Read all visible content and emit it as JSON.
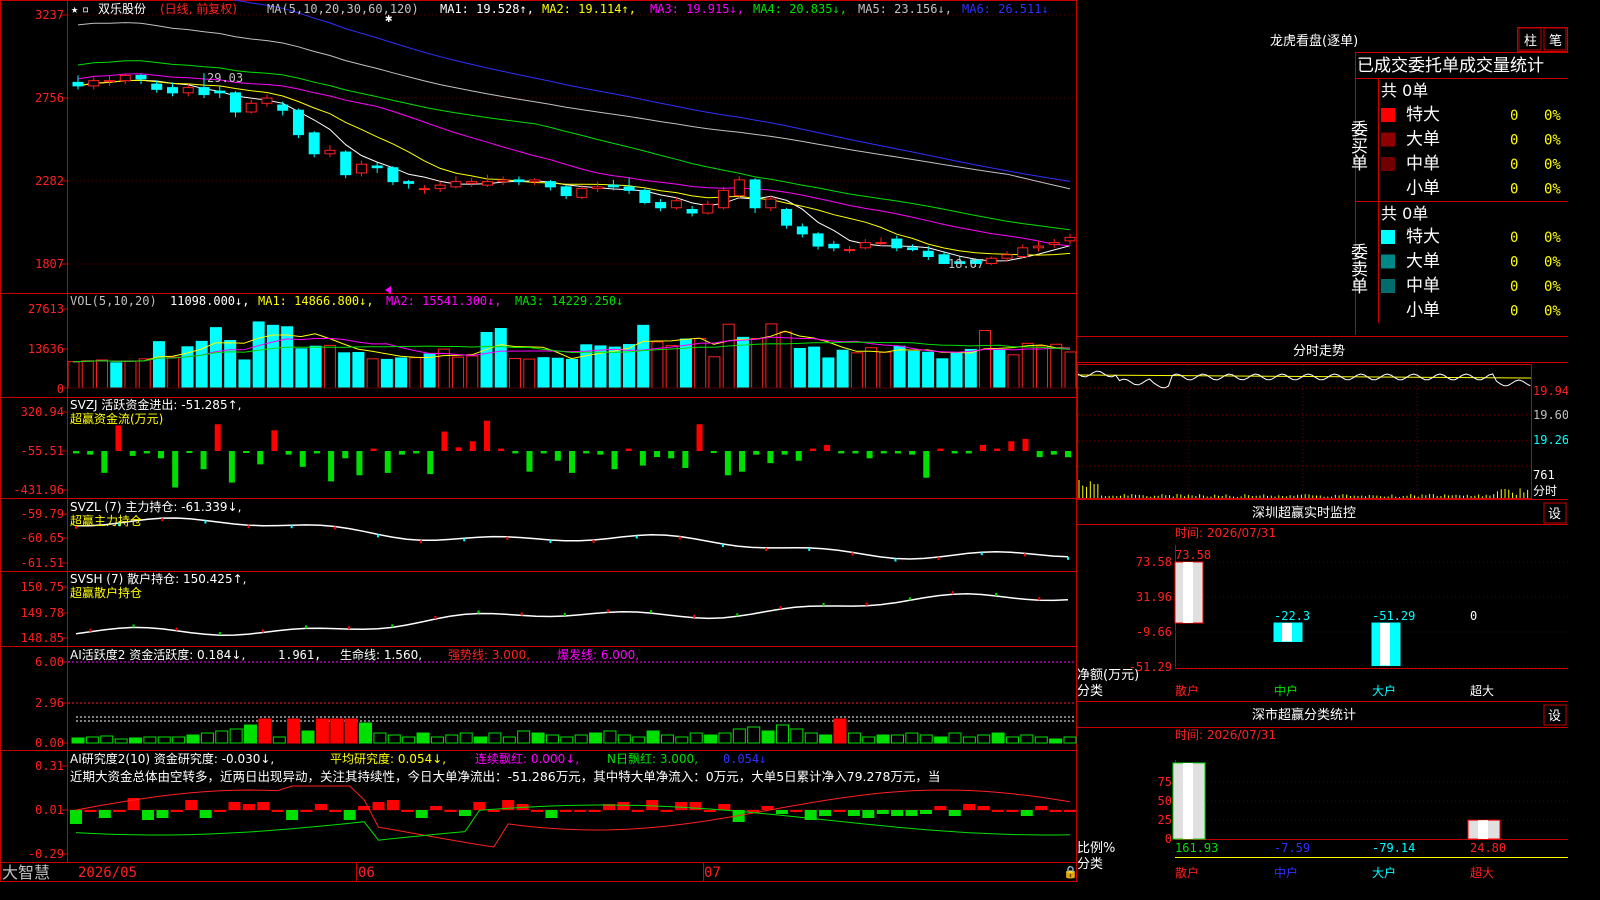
{
  "colors": {
    "up": "#ff2020",
    "down": "#00ffff",
    "green": "#00e000",
    "grid": "#c80000",
    "yellow": "#ffff00",
    "magenta": "#ff00ff",
    "blue": "#3030ff",
    "white": "#ffffff"
  },
  "main": {
    "stock": "双乐股份",
    "period": "(日线, 前复权)",
    "ma_params": "MA(5,10,20,30,60,120)",
    "ma_labels": [
      {
        "text": "MA1: 19.528↑,",
        "color": "#ffffff"
      },
      {
        "text": "MA2: 19.114↑,",
        "color": "#ffff00"
      },
      {
        "text": "MA3: 19.915↓,",
        "color": "#ff00ff"
      },
      {
        "text": "MA4: 20.835↓,",
        "color": "#00e000"
      },
      {
        "text": "MA5: 23.156↓,",
        "color": "#c0c0c0"
      },
      {
        "text": "MA6: 26.511↓",
        "color": "#3030ff"
      }
    ],
    "yticks": [
      "3237",
      "2756",
      "2282",
      "1807"
    ],
    "high_label": "29.03",
    "low_label": "18.07"
  },
  "vol": {
    "title": "VOL(5,10,20)",
    "v": "11098.000↓,",
    "ma1": "MA1: 14866.800↓,",
    "ma2": "MA2: 15541.300↓,",
    "ma3": "MA3: 14229.250↓",
    "yticks": [
      "27613",
      "13636",
      "0"
    ]
  },
  "svzj": {
    "title": "SVZJ  活跃资金进出: -51.285↑,",
    "sub": "超赢资金流(万元)",
    "yticks": [
      "320.94",
      "-55.51",
      "-431.96"
    ]
  },
  "svzl": {
    "title": "SVZL (7) 主力持仓: -61.339↓,",
    "sub": "超赢主力持仓",
    "yticks": [
      "-59.79",
      "-60.65",
      "-61.51"
    ]
  },
  "svsh": {
    "title": "SVSH (7) 散户持仓: 150.425↑,",
    "sub": "超赢散户持仓",
    "yticks": [
      "150.75",
      "149.78",
      "148.85"
    ]
  },
  "ai1": {
    "title": "AI活跃度2 资金活跃度: 0.184↓,",
    "v2": "1.961,",
    "v3": "生命线: 1.560,",
    "v4": "强势线: 3.000,",
    "v5": "爆发线: 6.000,",
    "yticks": [
      "6.00",
      "2.96",
      "0.00"
    ]
  },
  "ai2": {
    "title": "AI研究度2(10) 资金研究度: -0.030↓,",
    "v2": "平均研究度: 0.054↓,",
    "v3": "连续飘红: 0.000↓,",
    "v4": "N日飘红: 3.000,",
    "v5": "0.054↓",
    "desc": "近期大资金总体由空转多，近两日出现异动，关注其持续性，今日大单净流出：-51.286万元，其中特大单净流入：0万元，大单5日累计净入79.278万元，当",
    "yticks": [
      "0.31",
      "0.01",
      "-0.29"
    ]
  },
  "xaxis": {
    "brand": "大智慧",
    "labels": [
      "2026/05",
      "06",
      "07"
    ]
  },
  "dragon": {
    "title": "龙虎看盘(逐单)",
    "btn1": "柱",
    "btn2": "笔",
    "subtitle": "已成交委托单成交量统计",
    "buy_side": "委买单",
    "sell_side": "委卖单",
    "buy_total": "共 0单",
    "sell_total": "共 0单",
    "buy_rows": [
      {
        "name": "特大",
        "v": "0",
        "p": "0%",
        "c": "#ff0000"
      },
      {
        "name": "大单",
        "v": "0",
        "p": "0%",
        "c": "#900000"
      },
      {
        "name": "中单",
        "v": "0",
        "p": "0%",
        "c": "#700000"
      },
      {
        "name": "小单",
        "v": "0",
        "p": "0%",
        "c": ""
      }
    ],
    "sell_rows": [
      {
        "name": "特大",
        "v": "0",
        "p": "0%",
        "c": "#00ffff"
      },
      {
        "name": "大单",
        "v": "0",
        "p": "0%",
        "c": "#008888"
      },
      {
        "name": "中单",
        "v": "0",
        "p": "0%",
        "c": "#006c6c"
      },
      {
        "name": "小单",
        "v": "0",
        "p": "0%",
        "c": ""
      }
    ]
  },
  "intraday": {
    "title": "分时走势",
    "prices": [
      "19.94",
      "19.60",
      "19.26"
    ],
    "vol": "761",
    "unit": "分时"
  },
  "monitor": {
    "title": "深圳超赢实时监控",
    "btn": "设",
    "time": "时间: 2026/07/31",
    "yticks": [
      "73.58",
      "31.96",
      "-9.66",
      "-51.29"
    ],
    "ylabel": "净额(万元)",
    "xlabel": "分类",
    "categories": [
      "散户",
      "中户",
      "大户",
      "超大"
    ],
    "values": [
      73.58,
      -22.3,
      -51.29,
      0
    ],
    "value_labels": [
      "73.58",
      "-22.3",
      "-51.29",
      "0"
    ]
  },
  "classify": {
    "title": "深市超赢分类统计",
    "btn": "设",
    "time": "时间: 2026/07/31",
    "yticks": [
      "75",
      "50",
      "25",
      "0"
    ],
    "ylabel": "比例%",
    "xlabel": "分类",
    "categories": [
      "散户",
      "中户",
      "大户",
      "超大"
    ],
    "values": [
      161.93,
      -7.59,
      -79.14,
      24.8
    ],
    "value_labels": [
      "161.93",
      "-7.59",
      "-79.14",
      "24.80"
    ]
  },
  "chart_data": [
    {
      "type": "candlestick",
      "title": "双乐股份",
      "ylim": [
        17.5,
        32.8
      ],
      "ohlc": [
        [
          28.5,
          28.3,
          28.9,
          28.1
        ],
        [
          28.3,
          28.6,
          28.8,
          28.1
        ],
        [
          28.6,
          28.6,
          28.9,
          28.3
        ],
        [
          28.6,
          28.9,
          29.0,
          28.4
        ],
        [
          28.9,
          28.7,
          29.0,
          28.4
        ],
        [
          28.4,
          28.1,
          28.6,
          27.9
        ],
        [
          28.2,
          27.9,
          28.5,
          27.7
        ],
        [
          27.9,
          28.2,
          28.4,
          27.7
        ],
        [
          28.2,
          27.8,
          29.03,
          27.6
        ],
        [
          28.0,
          27.9,
          28.3,
          27.6
        ],
        [
          27.9,
          26.8,
          28.0,
          26.5
        ],
        [
          26.8,
          27.3,
          27.5,
          26.7
        ],
        [
          27.3,
          27.6,
          27.8,
          27.1
        ],
        [
          27.2,
          26.9,
          27.4,
          26.6
        ],
        [
          26.9,
          25.5,
          27.0,
          25.3
        ],
        [
          25.6,
          24.4,
          25.7,
          24.2
        ],
        [
          24.4,
          24.6,
          24.9,
          24.2
        ],
        [
          24.5,
          23.2,
          24.6,
          23.0
        ],
        [
          23.3,
          23.8,
          24.0,
          23.1
        ],
        [
          23.7,
          23.6,
          23.9,
          23.3
        ],
        [
          23.6,
          22.8,
          23.7,
          22.6
        ],
        [
          22.8,
          22.7,
          22.9,
          22.4
        ],
        [
          22.4,
          22.4,
          22.6,
          22.1
        ],
        [
          22.4,
          22.6,
          22.8,
          22.2
        ],
        [
          22.5,
          22.8,
          23.1,
          22.4
        ],
        [
          22.7,
          22.8,
          23.0,
          22.5
        ],
        [
          22.6,
          22.8,
          23.2,
          22.5
        ],
        [
          22.8,
          22.9,
          23.1,
          22.6
        ],
        [
          22.9,
          22.8,
          23.1,
          22.6
        ],
        [
          22.8,
          22.9,
          23.0,
          22.6
        ],
        [
          22.8,
          22.5,
          22.9,
          22.3
        ],
        [
          22.5,
          22.0,
          22.6,
          21.8
        ],
        [
          21.9,
          22.4,
          22.6,
          21.8
        ],
        [
          22.4,
          22.5,
          22.8,
          22.2
        ],
        [
          22.6,
          22.5,
          22.9,
          22.3
        ],
        [
          22.5,
          22.3,
          23.0,
          22.1
        ],
        [
          22.3,
          21.6,
          22.4,
          21.5
        ],
        [
          21.6,
          21.3,
          21.8,
          21.1
        ],
        [
          21.3,
          21.7,
          21.9,
          21.2
        ],
        [
          21.2,
          21.0,
          21.4,
          20.8
        ],
        [
          21.0,
          21.5,
          21.7,
          20.9
        ],
        [
          21.3,
          22.3,
          22.5,
          21.2
        ],
        [
          22.0,
          22.9,
          23.1,
          21.8
        ],
        [
          22.9,
          21.3,
          23.0,
          21.0
        ],
        [
          21.3,
          21.8,
          22.0,
          21.1
        ],
        [
          21.2,
          20.3,
          21.3,
          20.1
        ],
        [
          20.2,
          19.8,
          20.4,
          19.6
        ],
        [
          19.8,
          19.1,
          19.9,
          18.9
        ],
        [
          19.2,
          19.0,
          19.4,
          18.8
        ],
        [
          18.9,
          18.9,
          19.1,
          18.7
        ],
        [
          19.0,
          19.3,
          19.5,
          18.9
        ],
        [
          19.3,
          19.3,
          19.6,
          19.1
        ],
        [
          19.5,
          19.0,
          19.7,
          18.8
        ],
        [
          19.0,
          18.9,
          19.2,
          18.8
        ],
        [
          18.8,
          18.5,
          19.1,
          18.3
        ],
        [
          18.6,
          18.1,
          18.8,
          18.07
        ],
        [
          18.2,
          18.1,
          18.5,
          18.07
        ],
        [
          18.3,
          18.1,
          18.4,
          17.9
        ],
        [
          18.1,
          18.4,
          18.5,
          18.0
        ],
        [
          18.4,
          18.6,
          18.8,
          18.2
        ],
        [
          18.5,
          19.0,
          19.2,
          18.4
        ],
        [
          19.0,
          19.1,
          19.4,
          18.8
        ],
        [
          19.2,
          19.3,
          19.5,
          19.0
        ],
        [
          19.4,
          19.6,
          19.8,
          19.2
        ]
      ]
    },
    {
      "type": "bar",
      "title": "VOL(5,10,20)",
      "ylim": [
        0,
        27613
      ],
      "values": [
        9200,
        9500,
        9800,
        8800,
        9400,
        10200,
        16200,
        10800,
        14400,
        16300,
        21100,
        16600,
        9800,
        23100,
        21900,
        21400,
        13700,
        14600,
        14900,
        12300,
        12400,
        10200,
        10000,
        10500,
        10600,
        11900,
        13600,
        10800,
        11200,
        19400,
        20800,
        10300,
        10100,
        10600,
        10400,
        10000,
        15100,
        14700,
        14300,
        15200,
        21900,
        16100,
        14800,
        17100,
        17300,
        10900,
        22300,
        17700,
        17300,
        22400,
        19600,
        13800,
        14300,
        10500,
        13200,
        12300,
        14100,
        12500,
        14600,
        12800,
        12500,
        10200,
        12200,
        13500,
        20100,
        13200,
        11600,
        15600,
        14700,
        15300,
        12600
      ],
      "up": [
        1,
        1,
        1,
        0,
        1,
        1,
        0,
        1,
        0,
        0,
        0,
        0,
        0,
        0,
        0,
        0,
        0,
        0,
        1,
        0,
        0,
        1,
        0,
        0,
        1,
        0,
        1,
        1,
        1,
        0,
        0,
        1,
        1,
        0,
        0,
        0,
        0,
        0,
        0,
        0,
        0,
        1,
        1,
        0,
        1,
        1,
        1,
        0,
        1,
        1,
        1,
        0,
        0,
        0,
        0,
        1,
        1,
        1,
        0,
        0,
        0,
        0,
        0,
        0,
        1,
        0,
        1,
        1,
        1,
        1,
        1
      ]
    },
    {
      "type": "bar",
      "title": "SVZJ 活跃资金进出",
      "ylim": [
        -431.96,
        320.94
      ],
      "values": [
        -20,
        -30,
        -180,
        210,
        -40,
        -20,
        -60,
        -300,
        -10,
        -150,
        220,
        -260,
        -10,
        -110,
        170,
        -30,
        -130,
        -20,
        -250,
        -60,
        -200,
        20,
        -180,
        -30,
        -20,
        -190,
        160,
        30,
        80,
        250,
        20,
        -20,
        -170,
        -20,
        -80,
        -180,
        -20,
        -30,
        -150,
        20,
        -120,
        -50,
        -60,
        -140,
        220,
        -10,
        -200,
        -170,
        -30,
        -100,
        -30,
        -80,
        20,
        50,
        -20,
        -20,
        -60,
        -20,
        -20,
        -30,
        -220,
        20,
        -20,
        -20,
        50,
        20,
        80,
        100,
        -50,
        -30,
        -51.3
      ]
    }
  ]
}
